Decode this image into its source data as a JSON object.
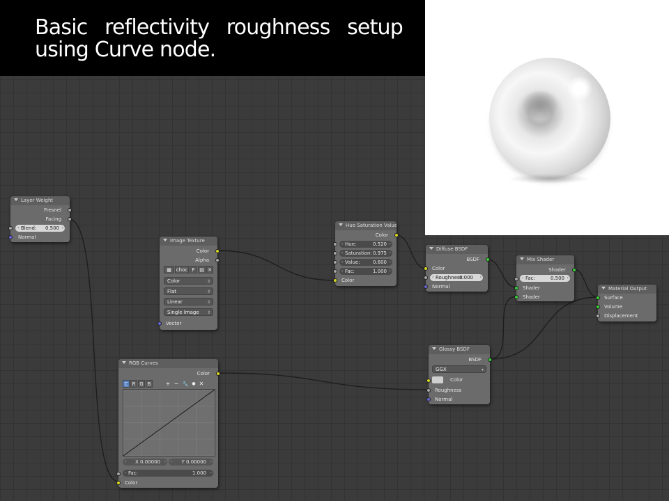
{
  "banner": {
    "title": "Basic reflectivity roughness setup using Curve node."
  },
  "colors": {
    "canvas": "#3b3b3b",
    "node_body": "#6b6b6b",
    "socket_color": "#d8d820",
    "socket_float": "#a8a8a8",
    "socket_vector": "#6565d6",
    "socket_shader": "#38d038",
    "active_channel": "#5680c2"
  },
  "nodes": {
    "layer_weight": {
      "title": "Layer Weight",
      "out_fresnel": "Fresnel",
      "out_facing": "Facing",
      "blend_label": "Blend:",
      "blend_value": "0.500",
      "in_normal": "Normal"
    },
    "image_texture": {
      "title": "Image Texture",
      "out_color": "Color",
      "out_alpha": "Alpha",
      "image_name": "choc",
      "fake_user": "F",
      "color_space": "Color",
      "projection": "Flat",
      "interpolation": "Linear",
      "source": "Single Image",
      "in_vector": "Vector"
    },
    "hue_sat": {
      "title": "Hue Saturation Value",
      "out_color": "Color",
      "hue_label": "Hue:",
      "hue_value": "0.520",
      "sat_label": "Saturation:",
      "sat_value": "0.975",
      "val_label": "Value:",
      "val_value": "0.600",
      "fac_label": "Fac:",
      "fac_value": "1.000",
      "in_color": "Color"
    },
    "diffuse": {
      "title": "Diffuse BSDF",
      "out_bsdf": "BSDF",
      "in_color": "Color",
      "rough_label": "Roughness:",
      "rough_value": "0.000",
      "in_normal": "Normal"
    },
    "mix_shader": {
      "title": "Mix Shader",
      "out_shader": "Shader",
      "fac_label": "Fac:",
      "fac_value": "0.500",
      "in_shader1": "Shader",
      "in_shader2": "Shader"
    },
    "material_output": {
      "title": "Material Output",
      "in_surface": "Surface",
      "in_volume": "Volume",
      "in_displacement": "Displacement"
    },
    "glossy": {
      "title": "Glossy BSDF",
      "out_bsdf": "BSDF",
      "distribution": "GGX",
      "in_color": "Color",
      "in_roughness": "Roughness",
      "in_normal": "Normal"
    },
    "rgb_curves": {
      "title": "RGB Curves",
      "out_color": "Color",
      "channels": [
        "C",
        "R",
        "G",
        "B"
      ],
      "tool_plus": "+",
      "tool_minus": "−",
      "tool_wrench": "🔧",
      "tool_dot": "●",
      "tool_x": "✕",
      "x_field": "X 0.00000",
      "y_field": "Y 0.00000",
      "fac_label": "Fac:",
      "fac_value": "1.000",
      "in_color": "Color"
    }
  }
}
